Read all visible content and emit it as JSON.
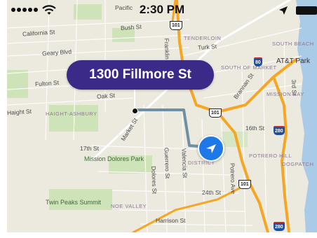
{
  "status_bar": {
    "time": "2:30 PM",
    "signal_icon": "signal-dots-icon",
    "wifi_icon": "wifi-icon",
    "location_icon": "location-arrow-icon",
    "battery_icon": "battery-icon"
  },
  "callout": {
    "address": "1300 Fillmore St"
  },
  "map": {
    "colors": {
      "land": "#ece9df",
      "park": "#cfe3b8",
      "water": "#a9cbe8",
      "freeway": "#f5a623",
      "route": "#6f8fa6",
      "callout": "#3b2a88",
      "nav_button": "#1e78e6"
    },
    "street_labels": [
      {
        "text": "California St"
      },
      {
        "text": "Geary Blvd"
      },
      {
        "text": "Fulton St"
      },
      {
        "text": "Oak St"
      },
      {
        "text": "Haight St"
      },
      {
        "text": "Market St"
      },
      {
        "text": "17th St"
      },
      {
        "text": "16th St"
      },
      {
        "text": "Bush St"
      },
      {
        "text": "Turk St"
      },
      {
        "text": "Franklin St"
      },
      {
        "text": "Brannan St"
      },
      {
        "text": "Valencia St"
      },
      {
        "text": "Guerrero St"
      },
      {
        "text": "Dolores St"
      },
      {
        "text": "Potrero Ave"
      },
      {
        "text": "24th St"
      },
      {
        "text": "Harrison St"
      },
      {
        "text": "3rd St"
      },
      {
        "text": "Pacific"
      }
    ],
    "area_labels": [
      {
        "text": "TENDERLOIN"
      },
      {
        "text": "SOUTH OF MARKET"
      },
      {
        "text": "SOUTH BEACH"
      },
      {
        "text": "MISSION BAY"
      },
      {
        "text": "HAIGHT-ASHBURY"
      },
      {
        "text": "POTRERO HILL"
      },
      {
        "text": "DOGPATCH"
      },
      {
        "text": "NOE VALLEY"
      },
      {
        "text": "DISTRICT"
      }
    ],
    "poi_labels": [
      {
        "text": "AT&T Park"
      },
      {
        "text": "Mission Dolores Park"
      },
      {
        "text": "Twin Peaks Summit"
      }
    ],
    "shields": [
      {
        "text": "101",
        "kind": "us"
      },
      {
        "text": "101",
        "kind": "us"
      },
      {
        "text": "101",
        "kind": "us"
      },
      {
        "text": "80",
        "kind": "i"
      },
      {
        "text": "280",
        "kind": "i"
      },
      {
        "text": "280",
        "kind": "i"
      }
    ]
  }
}
